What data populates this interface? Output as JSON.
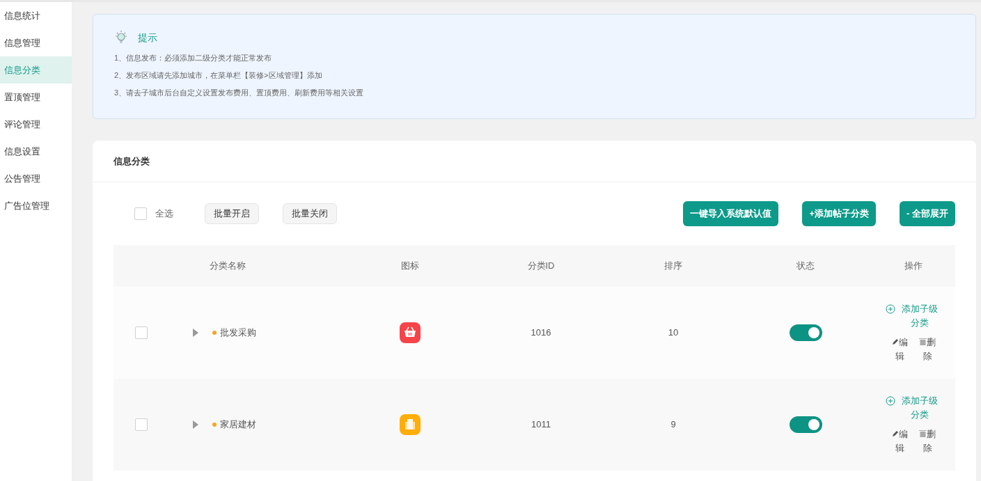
{
  "sidebar": {
    "items": [
      {
        "label": "信息统计",
        "selected": false
      },
      {
        "label": "信息管理",
        "selected": false
      },
      {
        "label": "信息分类",
        "selected": true
      },
      {
        "label": "置顶管理",
        "selected": false
      },
      {
        "label": "评论管理",
        "selected": false
      },
      {
        "label": "信息设置",
        "selected": false
      },
      {
        "label": "公告管理",
        "selected": false
      },
      {
        "label": "广告位管理",
        "selected": false
      }
    ]
  },
  "tips": {
    "title": "提示",
    "lines": [
      "1、信息发布：必须添加二级分类才能正常发布",
      "2、发布区域请先添加城市，在菜单栏【装修>区域管理】添加",
      "3、请去子城市后台自定义设置发布费用、置顶费用、刷新费用等相关设置"
    ]
  },
  "panel": {
    "title": "信息分类",
    "toolbar": {
      "select_all": {
        "label": "全选",
        "checked": false
      },
      "batch_buttons": [
        "批量开启",
        "批量关闭"
      ],
      "action_buttons": [
        "一键导入系统默认值",
        "+添加帖子分类",
        "- 全部展开"
      ]
    },
    "table": {
      "columns": [
        "分类名称",
        "图标",
        "分类ID",
        "排序",
        "状态",
        "操作"
      ],
      "rows": [
        {
          "checked": false,
          "expanded": false,
          "name": "批发采购",
          "icon": {
            "kind": "basket",
            "color": "#f5444a"
          },
          "id": "1016",
          "sort": "10",
          "on": true,
          "actions": {
            "add": "添加子级分类",
            "edit": "编辑",
            "delete": "删除"
          }
        },
        {
          "checked": false,
          "expanded": false,
          "name": "家居建材",
          "icon": {
            "kind": "building",
            "color": "#ffad0a"
          },
          "id": "1011",
          "sort": "9",
          "on": true,
          "actions": {
            "add": "添加子级分类",
            "edit": "编辑",
            "delete": "删除"
          }
        }
      ]
    }
  }
}
